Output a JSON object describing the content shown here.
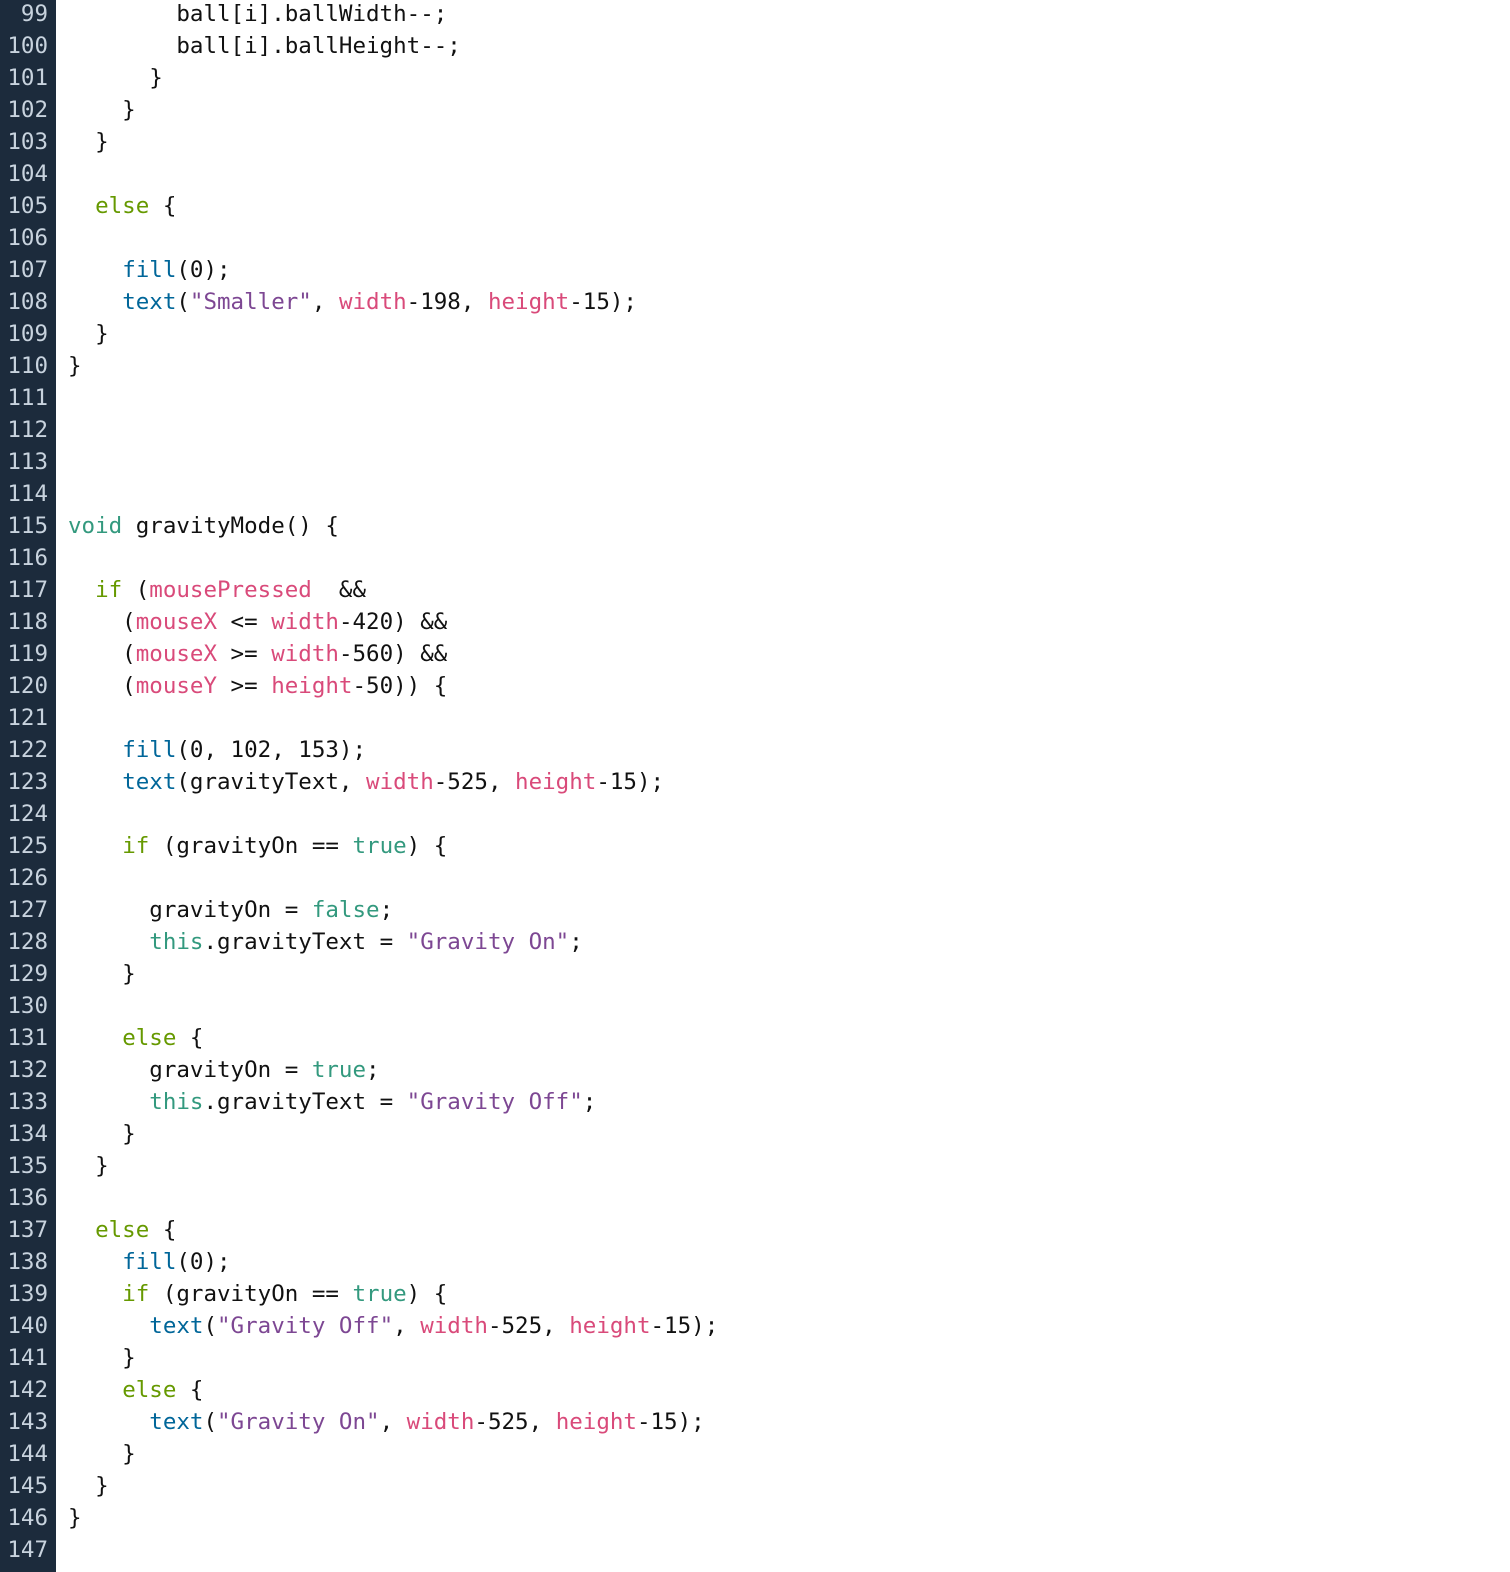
{
  "editor": {
    "colors": {
      "gutter_bg": "#1c2b3c",
      "line_number": "#c8d3de",
      "keyword": "#33997e",
      "function": "#006699",
      "builtin_variable": "#d94a7a",
      "string": "#7d4793",
      "control_flow": "#669900",
      "plain": "#111111"
    },
    "lines": [
      {
        "n": "99",
        "tokens": [
          {
            "t": "        ball[i].ballWidth--;",
            "c": "plain"
          }
        ]
      },
      {
        "n": "100",
        "tokens": [
          {
            "t": "        ball[i].ballHeight--;",
            "c": "plain"
          }
        ]
      },
      {
        "n": "101",
        "tokens": [
          {
            "t": "      }",
            "c": "plain"
          }
        ]
      },
      {
        "n": "102",
        "tokens": [
          {
            "t": "    }",
            "c": "plain"
          }
        ]
      },
      {
        "n": "103",
        "tokens": [
          {
            "t": "  }",
            "c": "plain"
          }
        ]
      },
      {
        "n": "104",
        "tokens": []
      },
      {
        "n": "105",
        "tokens": [
          {
            "t": "  ",
            "c": "plain"
          },
          {
            "t": "else",
            "c": "control"
          },
          {
            "t": " {",
            "c": "plain"
          }
        ]
      },
      {
        "n": "106",
        "tokens": []
      },
      {
        "n": "107",
        "tokens": [
          {
            "t": "    ",
            "c": "plain"
          },
          {
            "t": "fill",
            "c": "fn"
          },
          {
            "t": "(0);",
            "c": "plain"
          }
        ]
      },
      {
        "n": "108",
        "tokens": [
          {
            "t": "    ",
            "c": "plain"
          },
          {
            "t": "text",
            "c": "fn"
          },
          {
            "t": "(",
            "c": "plain"
          },
          {
            "t": "\"Smaller\"",
            "c": "string"
          },
          {
            "t": ", ",
            "c": "plain"
          },
          {
            "t": "width",
            "c": "builtin"
          },
          {
            "t": "-198, ",
            "c": "plain"
          },
          {
            "t": "height",
            "c": "builtin"
          },
          {
            "t": "-15);",
            "c": "plain"
          }
        ]
      },
      {
        "n": "109",
        "tokens": [
          {
            "t": "  }",
            "c": "plain"
          }
        ]
      },
      {
        "n": "110",
        "tokens": [
          {
            "t": "}",
            "c": "plain"
          }
        ]
      },
      {
        "n": "111",
        "tokens": []
      },
      {
        "n": "112",
        "tokens": []
      },
      {
        "n": "113",
        "tokens": []
      },
      {
        "n": "114",
        "tokens": []
      },
      {
        "n": "115",
        "tokens": [
          {
            "t": "void",
            "c": "keyword"
          },
          {
            "t": " gravityMode() {",
            "c": "plain"
          }
        ]
      },
      {
        "n": "116",
        "tokens": []
      },
      {
        "n": "117",
        "tokens": [
          {
            "t": "  ",
            "c": "plain"
          },
          {
            "t": "if",
            "c": "control"
          },
          {
            "t": " (",
            "c": "plain"
          },
          {
            "t": "mousePressed",
            "c": "builtin"
          },
          {
            "t": "  &&",
            "c": "plain"
          }
        ]
      },
      {
        "n": "118",
        "tokens": [
          {
            "t": "    (",
            "c": "plain"
          },
          {
            "t": "mouseX",
            "c": "builtin"
          },
          {
            "t": " <= ",
            "c": "plain"
          },
          {
            "t": "width",
            "c": "builtin"
          },
          {
            "t": "-420) &&",
            "c": "plain"
          }
        ]
      },
      {
        "n": "119",
        "tokens": [
          {
            "t": "    (",
            "c": "plain"
          },
          {
            "t": "mouseX",
            "c": "builtin"
          },
          {
            "t": " >= ",
            "c": "plain"
          },
          {
            "t": "width",
            "c": "builtin"
          },
          {
            "t": "-560) &&",
            "c": "plain"
          }
        ]
      },
      {
        "n": "120",
        "tokens": [
          {
            "t": "    (",
            "c": "plain"
          },
          {
            "t": "mouseY",
            "c": "builtin"
          },
          {
            "t": " >= ",
            "c": "plain"
          },
          {
            "t": "height",
            "c": "builtin"
          },
          {
            "t": "-50)) {",
            "c": "plain"
          }
        ]
      },
      {
        "n": "121",
        "tokens": []
      },
      {
        "n": "122",
        "tokens": [
          {
            "t": "    ",
            "c": "plain"
          },
          {
            "t": "fill",
            "c": "fn"
          },
          {
            "t": "(0, 102, 153);",
            "c": "plain"
          }
        ]
      },
      {
        "n": "123",
        "tokens": [
          {
            "t": "    ",
            "c": "plain"
          },
          {
            "t": "text",
            "c": "fn"
          },
          {
            "t": "(gravityText, ",
            "c": "plain"
          },
          {
            "t": "width",
            "c": "builtin"
          },
          {
            "t": "-525, ",
            "c": "plain"
          },
          {
            "t": "height",
            "c": "builtin"
          },
          {
            "t": "-15);",
            "c": "plain"
          }
        ]
      },
      {
        "n": "124",
        "tokens": []
      },
      {
        "n": "125",
        "tokens": [
          {
            "t": "    ",
            "c": "plain"
          },
          {
            "t": "if",
            "c": "control"
          },
          {
            "t": " (gravityOn == ",
            "c": "plain"
          },
          {
            "t": "true",
            "c": "keyword"
          },
          {
            "t": ") {",
            "c": "plain"
          }
        ]
      },
      {
        "n": "126",
        "tokens": []
      },
      {
        "n": "127",
        "tokens": [
          {
            "t": "      gravityOn = ",
            "c": "plain"
          },
          {
            "t": "false",
            "c": "keyword"
          },
          {
            "t": ";",
            "c": "plain"
          }
        ]
      },
      {
        "n": "128",
        "tokens": [
          {
            "t": "      ",
            "c": "plain"
          },
          {
            "t": "this",
            "c": "keyword"
          },
          {
            "t": ".gravityText = ",
            "c": "plain"
          },
          {
            "t": "\"Gravity On\"",
            "c": "string"
          },
          {
            "t": ";",
            "c": "plain"
          }
        ]
      },
      {
        "n": "129",
        "tokens": [
          {
            "t": "    }",
            "c": "plain"
          }
        ]
      },
      {
        "n": "130",
        "tokens": []
      },
      {
        "n": "131",
        "tokens": [
          {
            "t": "    ",
            "c": "plain"
          },
          {
            "t": "else",
            "c": "control"
          },
          {
            "t": " {",
            "c": "plain"
          }
        ]
      },
      {
        "n": "132",
        "tokens": [
          {
            "t": "      gravityOn = ",
            "c": "plain"
          },
          {
            "t": "true",
            "c": "keyword"
          },
          {
            "t": ";",
            "c": "plain"
          }
        ]
      },
      {
        "n": "133",
        "tokens": [
          {
            "t": "      ",
            "c": "plain"
          },
          {
            "t": "this",
            "c": "keyword"
          },
          {
            "t": ".gravityText = ",
            "c": "plain"
          },
          {
            "t": "\"Gravity Off\"",
            "c": "string"
          },
          {
            "t": ";",
            "c": "plain"
          }
        ]
      },
      {
        "n": "134",
        "tokens": [
          {
            "t": "    }",
            "c": "plain"
          }
        ]
      },
      {
        "n": "135",
        "tokens": [
          {
            "t": "  }",
            "c": "plain"
          }
        ]
      },
      {
        "n": "136",
        "tokens": []
      },
      {
        "n": "137",
        "tokens": [
          {
            "t": "  ",
            "c": "plain"
          },
          {
            "t": "else",
            "c": "control"
          },
          {
            "t": " {",
            "c": "plain"
          }
        ]
      },
      {
        "n": "138",
        "tokens": [
          {
            "t": "    ",
            "c": "plain"
          },
          {
            "t": "fill",
            "c": "fn"
          },
          {
            "t": "(0);",
            "c": "plain"
          }
        ]
      },
      {
        "n": "139",
        "tokens": [
          {
            "t": "    ",
            "c": "plain"
          },
          {
            "t": "if",
            "c": "control"
          },
          {
            "t": " (gravityOn == ",
            "c": "plain"
          },
          {
            "t": "true",
            "c": "keyword"
          },
          {
            "t": ") {",
            "c": "plain"
          }
        ]
      },
      {
        "n": "140",
        "tokens": [
          {
            "t": "      ",
            "c": "plain"
          },
          {
            "t": "text",
            "c": "fn"
          },
          {
            "t": "(",
            "c": "plain"
          },
          {
            "t": "\"Gravity Off\"",
            "c": "string"
          },
          {
            "t": ", ",
            "c": "plain"
          },
          {
            "t": "width",
            "c": "builtin"
          },
          {
            "t": "-525, ",
            "c": "plain"
          },
          {
            "t": "height",
            "c": "builtin"
          },
          {
            "t": "-15);",
            "c": "plain"
          }
        ]
      },
      {
        "n": "141",
        "tokens": [
          {
            "t": "    }",
            "c": "plain"
          }
        ]
      },
      {
        "n": "142",
        "tokens": [
          {
            "t": "    ",
            "c": "plain"
          },
          {
            "t": "else",
            "c": "control"
          },
          {
            "t": " {",
            "c": "plain"
          }
        ]
      },
      {
        "n": "143",
        "tokens": [
          {
            "t": "      ",
            "c": "plain"
          },
          {
            "t": "text",
            "c": "fn"
          },
          {
            "t": "(",
            "c": "plain"
          },
          {
            "t": "\"Gravity On\"",
            "c": "string"
          },
          {
            "t": ", ",
            "c": "plain"
          },
          {
            "t": "width",
            "c": "builtin"
          },
          {
            "t": "-525, ",
            "c": "plain"
          },
          {
            "t": "height",
            "c": "builtin"
          },
          {
            "t": "-15);",
            "c": "plain"
          }
        ]
      },
      {
        "n": "144",
        "tokens": [
          {
            "t": "    }",
            "c": "plain"
          }
        ]
      },
      {
        "n": "145",
        "tokens": [
          {
            "t": "  }",
            "c": "plain"
          }
        ]
      },
      {
        "n": "146",
        "tokens": [
          {
            "t": "}",
            "c": "plain"
          }
        ]
      },
      {
        "n": "147",
        "tokens": []
      }
    ]
  }
}
